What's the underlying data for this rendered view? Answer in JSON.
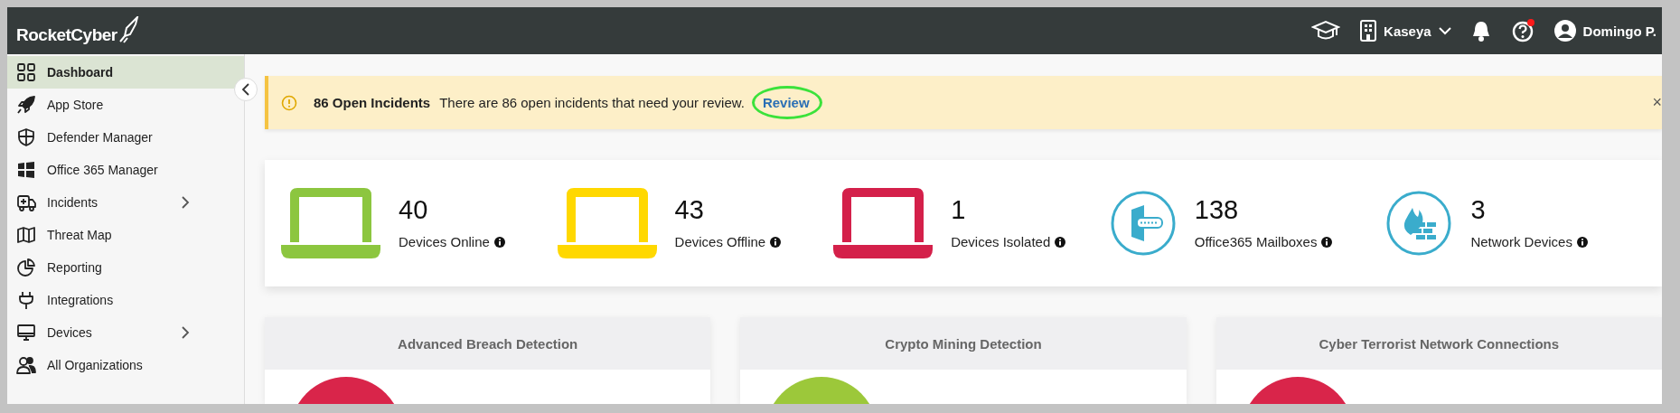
{
  "header": {
    "logo": "RocketCyber",
    "org": "Kaseya",
    "help_notification": true,
    "user": "Domingo P."
  },
  "sidebar": {
    "items": [
      {
        "label": "Dashboard",
        "selected": true,
        "expandable": false
      },
      {
        "label": "App Store",
        "selected": false,
        "expandable": false
      },
      {
        "label": "Defender Manager",
        "selected": false,
        "expandable": false
      },
      {
        "label": "Office 365 Manager",
        "selected": false,
        "expandable": false
      },
      {
        "label": "Incidents",
        "selected": false,
        "expandable": true
      },
      {
        "label": "Threat Map",
        "selected": false,
        "expandable": false
      },
      {
        "label": "Reporting",
        "selected": false,
        "expandable": false
      },
      {
        "label": "Integrations",
        "selected": false,
        "expandable": false
      },
      {
        "label": "Devices",
        "selected": false,
        "expandable": true
      },
      {
        "label": "All Organizations",
        "selected": false,
        "expandable": false
      }
    ]
  },
  "alert": {
    "title": "86 Open Incidents",
    "message": "There are 86 open incidents that need your review.",
    "link": "Review",
    "link_highlighted": true,
    "close": "×"
  },
  "stats": [
    {
      "kind": "laptop",
      "color": "#8cc63f",
      "value": "40",
      "label": "Devices Online"
    },
    {
      "kind": "laptop",
      "color": "#ffd800",
      "value": "43",
      "label": "Devices Offline"
    },
    {
      "kind": "laptop",
      "color": "#d4204a",
      "value": "1",
      "label": "Devices Isolated"
    },
    {
      "kind": "mailbox",
      "color": "#3aaccc",
      "value": "138",
      "label": "Office365 Mailboxes"
    },
    {
      "kind": "firewall",
      "color": "#3aaccc",
      "value": "3",
      "label": "Network Devices"
    }
  ],
  "detections": [
    {
      "title": "Advanced Breach Detection",
      "color": "#d9254a"
    },
    {
      "title": "Crypto Mining Detection",
      "color": "#9cc83a"
    },
    {
      "title": "Cyber Terrorist Network Connections",
      "color": "#d9254a"
    }
  ]
}
